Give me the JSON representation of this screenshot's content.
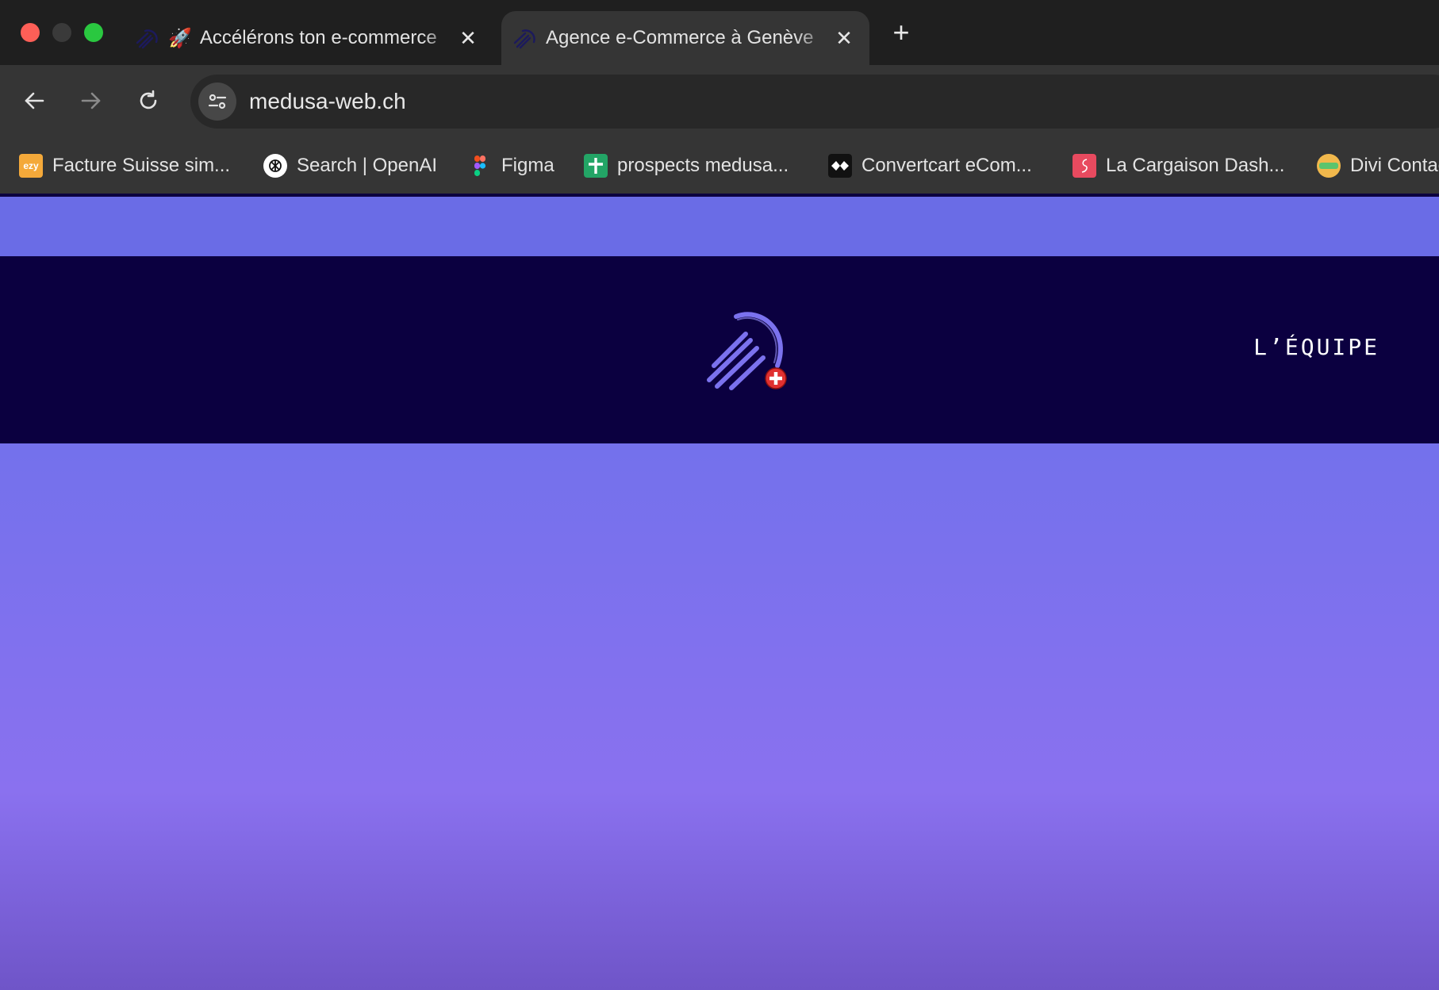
{
  "browser": {
    "tabs": [
      {
        "title": "Accélérons ton e-commerce",
        "rocket": "🚀",
        "favicon": "medusa-logo-icon",
        "close": "✕"
      },
      {
        "title": "Agence e-Commerce à Genève",
        "favicon": "medusa-logo-icon",
        "close": "✕",
        "active": true
      }
    ],
    "new_tab": "+",
    "address": "medusa-web.ch",
    "bookmarks": [
      {
        "label": "Facture Suisse sim...",
        "icon": "ezy-icon",
        "icon_text": "ezy"
      },
      {
        "label": "Search | OpenAI",
        "icon": "openai-icon"
      },
      {
        "label": "Figma",
        "icon": "figma-icon"
      },
      {
        "label": "prospects medusa...",
        "icon": "sheets-icon"
      },
      {
        "label": "Convertcart eCom...",
        "icon": "convertcart-icon"
      },
      {
        "label": "La Cargaison Dash...",
        "icon": "cargaison-icon"
      },
      {
        "label": "Divi Contact",
        "icon": "divi-icon"
      }
    ]
  },
  "site": {
    "nav": {
      "equipe": "L’ÉQUIPE"
    },
    "colors": {
      "header_bg": "#0b0040",
      "top_band": "#6a6ce6",
      "accent": "#7b72ee",
      "swiss_red": "#e03030"
    }
  }
}
